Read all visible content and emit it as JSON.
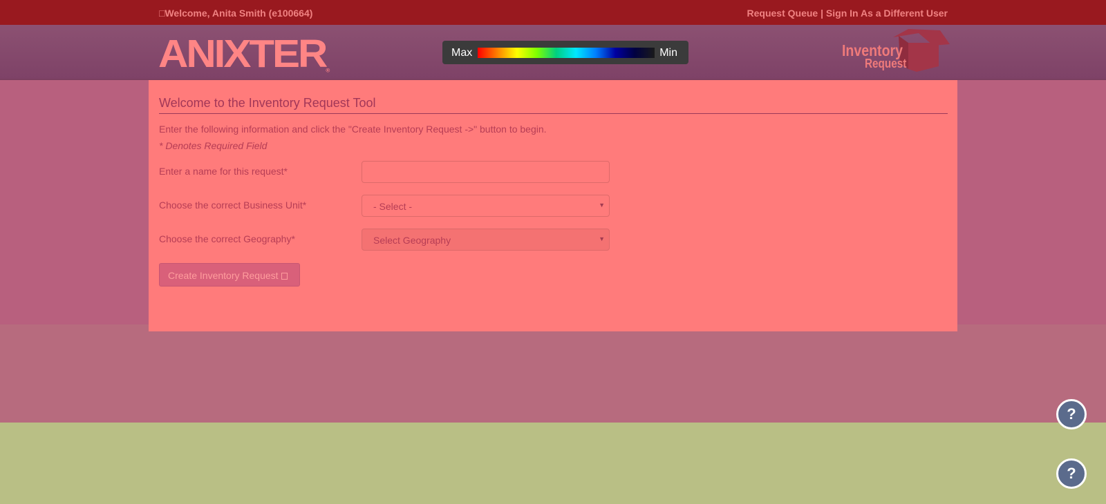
{
  "topbar": {
    "welcome": "□Welcome, Anita Smith (e100664)",
    "request_queue": "Request Queue",
    "separator": " | ",
    "sign_in_other": "Sign In As a Different User"
  },
  "header": {
    "logo_text": "ANIXTER",
    "logo_mark": "®",
    "scale_max": "Max",
    "scale_min": "Min",
    "app_logo_line1": "Inventory",
    "app_logo_line2": "Request"
  },
  "form": {
    "title": "Welcome to the Inventory Request Tool",
    "intro": "Enter the following information and click the \"Create Inventory Request ->\" button to begin.",
    "required_note": "* Denotes Required Field",
    "name_label": "Enter a name for this request*",
    "name_value": "",
    "business_unit_label": "Choose the correct Business Unit*",
    "business_unit_value": "- Select -",
    "geography_label": "Choose the correct Geography*",
    "geography_value": "Select Geography",
    "create_button": "Create Inventory Request"
  },
  "help": {
    "help1": "?",
    "help2": "?"
  },
  "colors": {
    "topbar": "#99191f",
    "panel": "#ff7b7b",
    "help_button": "#5b6b8c"
  }
}
